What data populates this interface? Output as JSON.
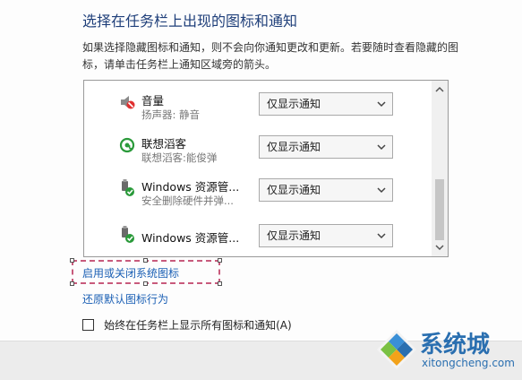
{
  "header": {
    "title": "选择在任务栏上出现的图标和通知",
    "description": "如果选择隐藏图标和通知，则不会向你通知更改和更新。若要随时查看隐藏的图标，请单击任务栏上通知区域旁的箭头。"
  },
  "icons_list": [
    {
      "name": "音量",
      "subtitle": "扬声器: 静音",
      "icon": "volume-muted-icon",
      "behavior": "仅显示通知"
    },
    {
      "name": "联想滔客",
      "subtitle": "联想滔客:能俊弹",
      "icon": "lenovo-chat-icon",
      "behavior": "仅显示通知"
    },
    {
      "name": "Windows 资源管...",
      "subtitle": "安全删除硬件并弹...",
      "icon": "usb-device-icon",
      "behavior": "仅显示通知"
    },
    {
      "name": "Windows 资源管...",
      "subtitle": "",
      "icon": "usb-device-icon",
      "behavior": "仅显示通知"
    }
  ],
  "links": {
    "system_icons": "启用或关闭系统图标",
    "restore_defaults": "还原默认图标行为"
  },
  "options": {
    "always_show_all": "始终在任务栏上显示所有图标和通知(A)"
  },
  "watermark": {
    "brand": "系统城",
    "url": "xitongcheng.com"
  },
  "colors": {
    "title": "#1f3f7a",
    "link": "#1a5fb4",
    "selection_border": "#c85a7c",
    "watermark": "#2a6fb0"
  }
}
